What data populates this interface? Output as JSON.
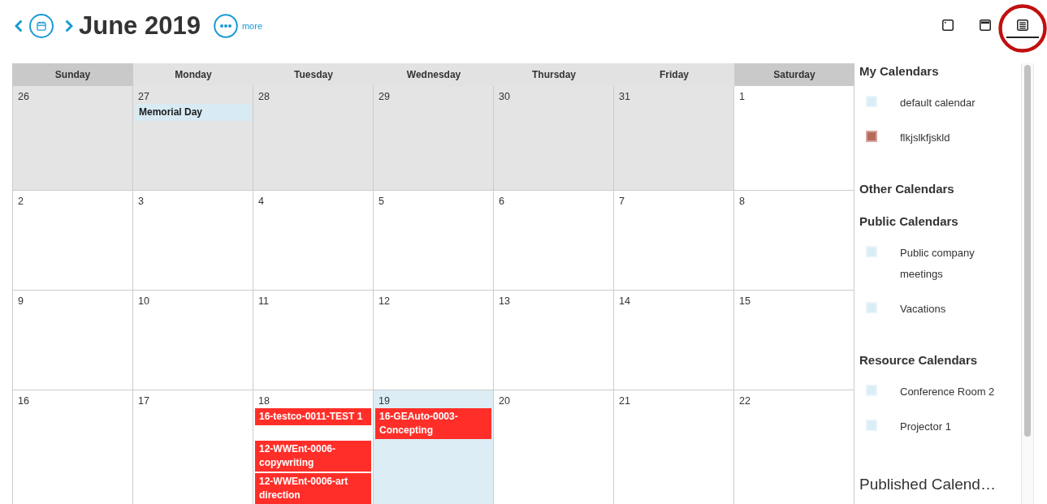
{
  "toolbar": {
    "title": "June 2019",
    "more_label": "more",
    "views": [
      {
        "kind": "day",
        "selected": false,
        "circled": false
      },
      {
        "kind": "week",
        "selected": false,
        "circled": false
      },
      {
        "kind": "month",
        "selected": true,
        "circled": true
      }
    ]
  },
  "calendar": {
    "weekdays": [
      {
        "label": "Sunday",
        "weekend": true
      },
      {
        "label": "Monday",
        "weekend": false
      },
      {
        "label": "Tuesday",
        "weekend": false
      },
      {
        "label": "Wednesday",
        "weekend": false
      },
      {
        "label": "Thursday",
        "weekend": false
      },
      {
        "label": "Friday",
        "weekend": false
      },
      {
        "label": "Saturday",
        "weekend": true
      }
    ],
    "weeks": [
      {
        "days": [
          {
            "number": "26",
            "outside_month": true,
            "today": false
          },
          {
            "number": "27",
            "outside_month": true,
            "today": false,
            "events": [
              {
                "title": "Memorial Day",
                "kind": "holiday"
              }
            ]
          },
          {
            "number": "28",
            "outside_month": true,
            "today": false
          },
          {
            "number": "29",
            "outside_month": true,
            "today": false
          },
          {
            "number": "30",
            "outside_month": true,
            "today": false
          },
          {
            "number": "31",
            "outside_month": true,
            "today": false
          },
          {
            "number": "1",
            "outside_month": false,
            "today": false
          }
        ]
      },
      {
        "days": [
          {
            "number": "2",
            "outside_month": false,
            "today": false
          },
          {
            "number": "3",
            "outside_month": false,
            "today": false
          },
          {
            "number": "4",
            "outside_month": false,
            "today": false
          },
          {
            "number": "5",
            "outside_month": false,
            "today": false
          },
          {
            "number": "6",
            "outside_month": false,
            "today": false
          },
          {
            "number": "7",
            "outside_month": false,
            "today": false
          },
          {
            "number": "8",
            "outside_month": false,
            "today": false
          }
        ]
      },
      {
        "days": [
          {
            "number": "9",
            "outside_month": false,
            "today": false
          },
          {
            "number": "10",
            "outside_month": false,
            "today": false
          },
          {
            "number": "11",
            "outside_month": false,
            "today": false
          },
          {
            "number": "12",
            "outside_month": false,
            "today": false
          },
          {
            "number": "13",
            "outside_month": false,
            "today": false
          },
          {
            "number": "14",
            "outside_month": false,
            "today": false
          },
          {
            "number": "15",
            "outside_month": false,
            "today": false
          }
        ]
      },
      {
        "days": [
          {
            "number": "16",
            "outside_month": false,
            "today": false
          },
          {
            "number": "17",
            "outside_month": false,
            "today": false
          },
          {
            "number": "18",
            "outside_month": false,
            "today": false,
            "events": [
              {
                "title": "16-testco-0011-TEST 1",
                "kind": "task"
              },
              {
                "title": "12-WWEnt-0006-copywriting",
                "kind": "task"
              },
              {
                "title": "12-WWEnt-0006-art direction",
                "kind": "task"
              }
            ]
          },
          {
            "number": "19",
            "outside_month": false,
            "today": true,
            "events": [
              {
                "title": "16-GEAuto-0003-Concepting",
                "kind": "task"
              }
            ]
          },
          {
            "number": "20",
            "outside_month": false,
            "today": false
          },
          {
            "number": "21",
            "outside_month": false,
            "today": false
          },
          {
            "number": "22",
            "outside_month": false,
            "today": false
          }
        ]
      }
    ]
  },
  "sidebar": {
    "groups": [
      {
        "title": "My Calendars",
        "kind": "subheading",
        "calendars": [
          {
            "name": "default calendar",
            "color": "#d9edf5"
          },
          {
            "name": "flkjslkfjskld",
            "color": "#b66a5d"
          }
        ]
      },
      {
        "title": "Other Calendars",
        "kind": "subheading"
      },
      {
        "title": "Public Calendars",
        "kind": "subheading",
        "calendars": [
          {
            "name": "Public company meetings",
            "color": "#d9edf5"
          },
          {
            "name": "Vacations",
            "color": "#d9edf5"
          }
        ]
      },
      {
        "title": "Resource Calendars",
        "kind": "subheading",
        "calendars": [
          {
            "name": "Conference Room 2",
            "color": "#d9edf5"
          },
          {
            "name": "Projector 1",
            "color": "#d9edf5"
          }
        ]
      },
      {
        "title": "Published Calend…",
        "kind": "heading"
      }
    ]
  }
}
